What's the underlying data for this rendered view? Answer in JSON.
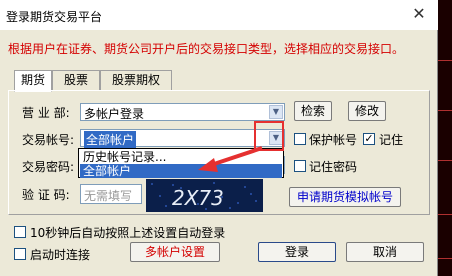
{
  "window": {
    "title": "登录期货交易平台"
  },
  "instruction": "根据用户在证券、期货公司开户后的交易接口类型，选择相应的交易接口。",
  "tabs": [
    {
      "label": "期货",
      "active": true
    },
    {
      "label": "股票",
      "active": false
    },
    {
      "label": "股票期权",
      "active": false
    }
  ],
  "form": {
    "branch_label": "营 业 部:",
    "branch_value": "多帐户登录",
    "search_button": "检索",
    "modify_button": "修改",
    "account_label": "交易帐号:",
    "account_value": "全部帐户",
    "protect_account_label": "保护帐号",
    "protect_account_checked": false,
    "remember_label": "记住",
    "remember_checked": true,
    "password_label": "交易密码:",
    "remember_password_label": "记住密码",
    "remember_password_checked": false,
    "captcha_label": "验 证 码:",
    "captcha_placeholder": "无需填写",
    "captcha_text": "2X73",
    "apply_sim_button": "申请期货模拟帐号"
  },
  "dropdown": {
    "options": [
      "历史帐号记录...",
      "全部帐户"
    ],
    "selected": "全部帐户"
  },
  "options": {
    "auto_login_label": "10秒钟后自动按照上述设置自动登录",
    "auto_login_checked": false,
    "connect_on_start_label": "启动时连接",
    "connect_on_start_checked": false
  },
  "footer": {
    "multi_account_button": "多帐户设置",
    "login_button": "登录",
    "cancel_button": "取消"
  },
  "colors": {
    "instruction": "#d40000",
    "annotation": "#e53030",
    "selection": "#316ac5"
  }
}
